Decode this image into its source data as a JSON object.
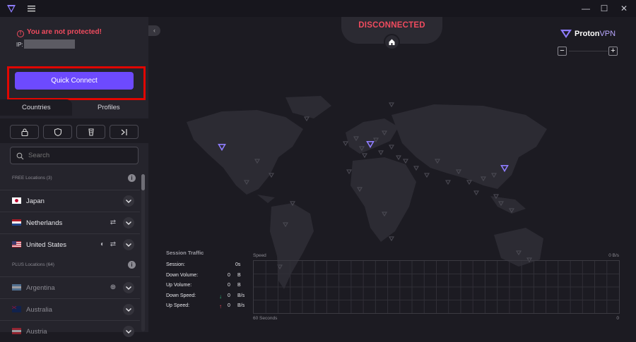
{
  "window": {
    "controls": {
      "minimize": "—",
      "maximize": "☐",
      "close": "✕"
    }
  },
  "sidebar": {
    "warning": "You are not protected!",
    "ip_label": "IP:",
    "quick_connect": "Quick Connect",
    "tabs": [
      {
        "label": "Countries"
      },
      {
        "label": "Profiles"
      }
    ],
    "search_placeholder": "Search",
    "free_section": "FREE Locations (3)",
    "plus_section": "PLUS Locations (64)",
    "countries": [
      {
        "name": "Japan",
        "flag": "japan-flag-icon"
      },
      {
        "name": "Netherlands",
        "flag": "netherlands-flag-icon"
      },
      {
        "name": "United States",
        "flag": "us-flag-icon"
      },
      {
        "name": "Argentina",
        "flag": "argentina-flag-icon"
      },
      {
        "name": "Australia",
        "flag": "australia-flag-icon"
      },
      {
        "name": "Austria",
        "flag": "austria-flag-icon"
      }
    ],
    "info_glyph": "i"
  },
  "main": {
    "status": "DISCONNECTED",
    "brand_part1": "Proton",
    "brand_part2": "VPN",
    "zoom_minus": "−",
    "zoom_plus": "+"
  },
  "traffic": {
    "title": "Session Traffic",
    "rows": [
      {
        "label": "Session:",
        "value": "0s",
        "unit": "",
        "arrow": ""
      },
      {
        "label": "Down Volume:",
        "value": "0",
        "unit": "B",
        "arrow": ""
      },
      {
        "label": "Up Volume:",
        "value": "0",
        "unit": "B",
        "arrow": ""
      },
      {
        "label": "Down Speed:",
        "value": "0",
        "unit": "B/s",
        "arrow": "↓"
      },
      {
        "label": "Up Speed:",
        "value": "0",
        "unit": "B/s",
        "arrow": "↑"
      }
    ],
    "speed_label": "Speed",
    "speed_max": "0  B/s",
    "time_label": "60 Seconds",
    "time_end": "0"
  },
  "colors": {
    "accent": "#6d4aff",
    "danger": "#ef4b5e",
    "highlight_frame": "#e10600",
    "down_arrow": "#2ec27e",
    "up_arrow": "#ef4b5e"
  }
}
